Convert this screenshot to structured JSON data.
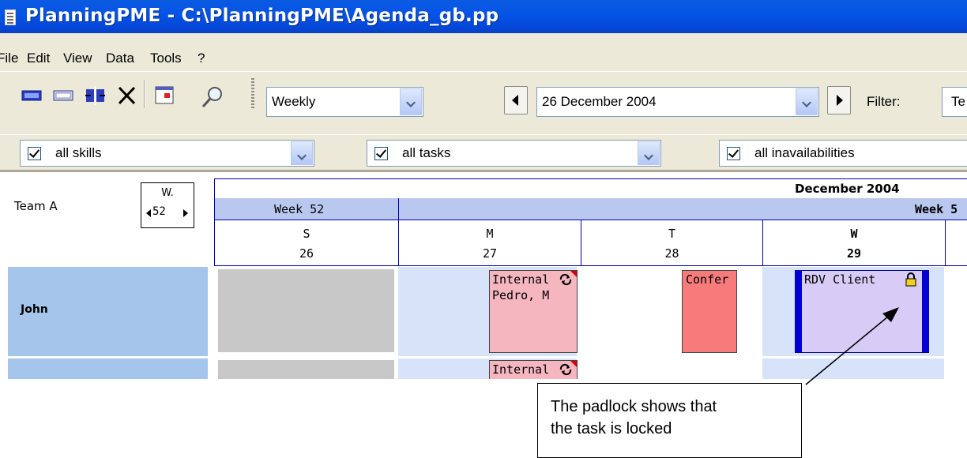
{
  "window": {
    "title": "PlanningPME - C:\\PlanningPME\\Agenda_gb.pp"
  },
  "menu": [
    "File",
    "Edit",
    "View",
    "Data",
    "Tools",
    "?"
  ],
  "toolbar": {
    "icons": [
      "add-task-icon",
      "edit-task-icon",
      "split-icon",
      "delete-icon",
      "calendar-icon",
      "search-icon"
    ],
    "view_mode": "Weekly",
    "date": "26 December 2004",
    "filter_label": "Filter:",
    "filter_value": "Te"
  },
  "filters": {
    "skills": "all skills",
    "tasks": "all tasks",
    "inavailabilities": "all inavailabilities"
  },
  "planning": {
    "team": "Team A",
    "week_selector": {
      "label": "W.",
      "value": "52"
    },
    "month": "December 2004",
    "weeks": [
      "Week 52",
      "Week 5"
    ],
    "days": [
      {
        "letter": "S",
        "number": "26"
      },
      {
        "letter": "M",
        "number": "27"
      },
      {
        "letter": "T",
        "number": "28"
      },
      {
        "letter": "W",
        "number": "29"
      }
    ],
    "resources": [
      "John"
    ],
    "tasks": {
      "internal_1_title": "Internal",
      "internal_1_people": "Pedro, M",
      "confer": "Confer",
      "rdv": "RDV Client",
      "internal_2_title": "Internal"
    }
  },
  "callout": {
    "line1": "The padlock shows that",
    "line2": "the task is locked"
  },
  "colors": {
    "titlebar": "#0555e7",
    "chrome": "#ece9d8",
    "header_blue": "#b9c8ee",
    "resource_blue": "#a5c5eb",
    "task_pink": "#f5b6c0",
    "task_red": "#f77b7b",
    "task_lavender": "#d8cbf5",
    "task_border_blue": "#0000d0"
  }
}
